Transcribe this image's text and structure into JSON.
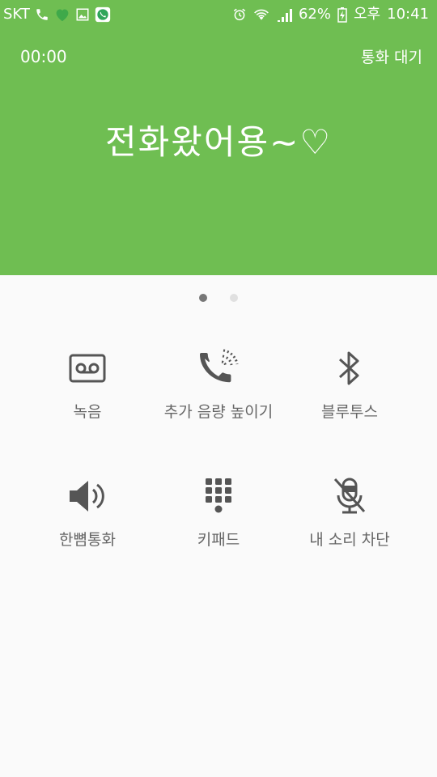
{
  "status_bar": {
    "carrier": "SKT",
    "battery": "62%",
    "ampm": "오후",
    "time": "10:41"
  },
  "call": {
    "timer": "00:00",
    "hold_label": "통화 대기",
    "caller_name": "전화왔어용~♡"
  },
  "controls": [
    {
      "label": "녹음",
      "icon": "record-icon"
    },
    {
      "label": "추가 음량 높이기",
      "icon": "extra-volume-icon"
    },
    {
      "label": "블루투스",
      "icon": "bluetooth-icon"
    },
    {
      "label": "한뼘통화",
      "icon": "speaker-icon"
    },
    {
      "label": "키패드",
      "icon": "keypad-icon"
    },
    {
      "label": "내 소리 차단",
      "icon": "mute-mic-icon"
    }
  ],
  "colors": {
    "accent": "#6fbe52",
    "icon": "#555555",
    "label": "#666666"
  }
}
